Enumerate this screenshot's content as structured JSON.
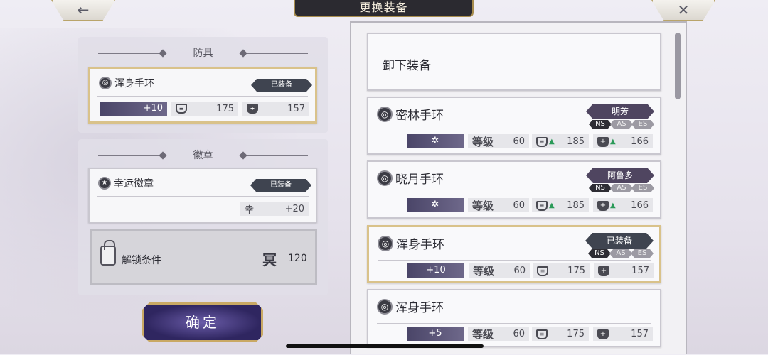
{
  "header": {
    "title": "更换装备",
    "back_icon": "←",
    "close_icon": "✕"
  },
  "left": {
    "armor_section": {
      "title": "防具",
      "item": {
        "name": "浑身手环",
        "badge": "已装备",
        "plus": "+10",
        "defense": "175",
        "hp": "157"
      }
    },
    "badge_section": {
      "title": "徽章",
      "item": {
        "name": "幸运徽章",
        "badge": "已装备",
        "stat_label": "幸",
        "stat_value": "+20"
      },
      "locked": {
        "label": "解锁条件",
        "icon_char": "冥",
        "value": "120"
      }
    },
    "confirm_label": "确定"
  },
  "right": {
    "unequip_label": "卸下装备",
    "level_label": "等级",
    "tags": [
      "NS",
      "AS",
      "ES"
    ],
    "items": [
      {
        "name": "密林手环",
        "owner": "明芳",
        "plus": "✲",
        "level": "60",
        "defense": "185",
        "defense_up": true,
        "hp": "166",
        "hp_up": true,
        "equipped": false
      },
      {
        "name": "晓月手环",
        "owner": "阿鲁多",
        "plus": "✲",
        "level": "60",
        "defense": "185",
        "defense_up": true,
        "hp": "166",
        "hp_up": true,
        "equipped": false
      },
      {
        "name": "浑身手环",
        "owner": "已装备",
        "plus": "+10",
        "level": "60",
        "defense": "175",
        "defense_up": false,
        "hp": "157",
        "hp_up": false,
        "equipped": true
      },
      {
        "name": "浑身手环",
        "owner": "",
        "plus": "+5",
        "level": "60",
        "defense": "175",
        "defense_up": false,
        "hp": "157",
        "hp_up": false,
        "equipped": false
      }
    ]
  },
  "colors": {
    "accent_gold": "#d9c28a",
    "stat_up": "#2a9a58",
    "bar_purple": "#4a4568"
  }
}
